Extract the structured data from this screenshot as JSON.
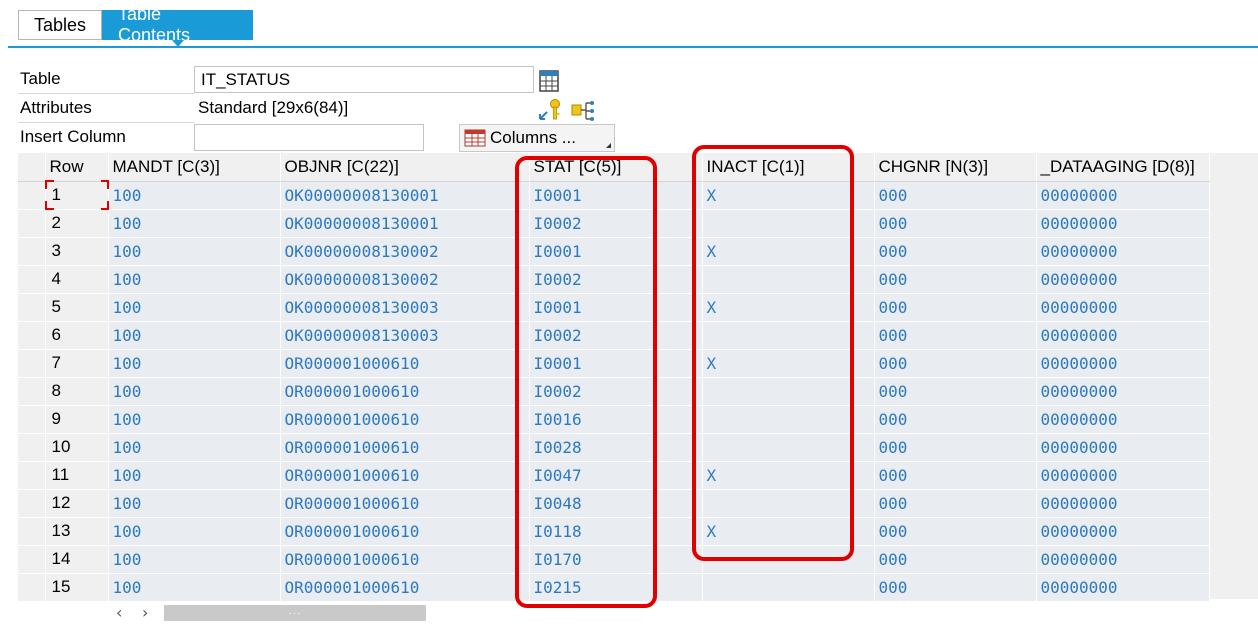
{
  "tabs": [
    {
      "label": "Tables",
      "active": false
    },
    {
      "label": "Table Contents",
      "active": true
    }
  ],
  "attributes": {
    "table_label": "Table",
    "table_value": "IT_STATUS",
    "attributes_label": "Attributes",
    "attributes_value": "Standard [29x6(84)]",
    "insert_column_label": "Insert Column",
    "insert_column_value": "",
    "columns_button_label": "Columns ..."
  },
  "grid": {
    "headers": [
      "Row",
      "MANDT [C(3)]",
      "OBJNR [C(22)]",
      "STAT [C(5)]",
      "INACT [C(1)]",
      "CHGNR [N(3)]",
      "_DATAAGING [D(8)]"
    ],
    "rows": [
      [
        "1",
        "100",
        "OK00000008130001",
        "I0001",
        "X",
        "000",
        "00000000"
      ],
      [
        "2",
        "100",
        "OK00000008130001",
        "I0002",
        "",
        "000",
        "00000000"
      ],
      [
        "3",
        "100",
        "OK00000008130002",
        "I0001",
        "X",
        "000",
        "00000000"
      ],
      [
        "4",
        "100",
        "OK00000008130002",
        "I0002",
        "",
        "000",
        "00000000"
      ],
      [
        "5",
        "100",
        "OK00000008130003",
        "I0001",
        "X",
        "000",
        "00000000"
      ],
      [
        "6",
        "100",
        "OK00000008130003",
        "I0002",
        "",
        "000",
        "00000000"
      ],
      [
        "7",
        "100",
        "OR000001000610",
        "I0001",
        "X",
        "000",
        "00000000"
      ],
      [
        "8",
        "100",
        "OR000001000610",
        "I0002",
        "",
        "000",
        "00000000"
      ],
      [
        "9",
        "100",
        "OR000001000610",
        "I0016",
        "",
        "000",
        "00000000"
      ],
      [
        "10",
        "100",
        "OR000001000610",
        "I0028",
        "",
        "000",
        "00000000"
      ],
      [
        "11",
        "100",
        "OR000001000610",
        "I0047",
        "X",
        "000",
        "00000000"
      ],
      [
        "12",
        "100",
        "OR000001000610",
        "I0048",
        "",
        "000",
        "00000000"
      ],
      [
        "13",
        "100",
        "OR000001000610",
        "I0118",
        "X",
        "000",
        "00000000"
      ],
      [
        "14",
        "100",
        "OR000001000610",
        "I0170",
        "",
        "000",
        "00000000"
      ],
      [
        "15",
        "100",
        "OR000001000610",
        "I0215",
        "",
        "000",
        "00000000"
      ]
    ]
  },
  "scrollbar": {
    "left_icon": "chevron-left-icon",
    "right_icon": "chevron-right-icon",
    "thumb_grip": "···"
  },
  "colors": {
    "accent": "#1a9ad6",
    "cell_text": "#2d79c0",
    "highlight": "#e10000"
  }
}
